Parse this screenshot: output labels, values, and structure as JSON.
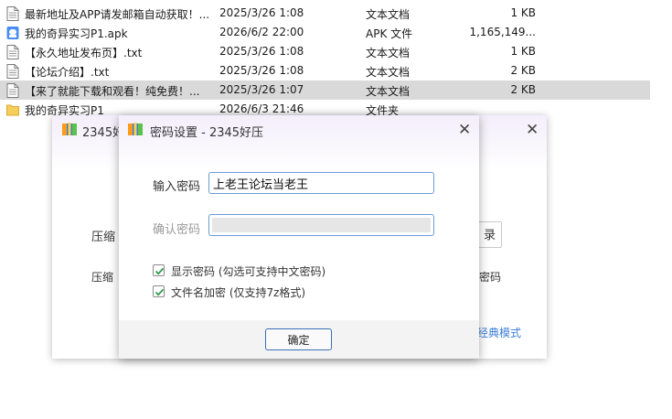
{
  "files": [
    {
      "name": "最新地址及APP请发邮箱自动获取！...",
      "date": "2025/3/26 1:08",
      "type": "文本文档",
      "size": "1 KB",
      "icon": "text-file-icon",
      "selected": false
    },
    {
      "name": "我的奇异实习P1.apk",
      "date": "2026/6/2 22:00",
      "type": "APK 文件",
      "size": "1,165,149...",
      "icon": "apk-file-icon",
      "selected": false
    },
    {
      "name": "【永久地址发布页】.txt",
      "date": "2025/3/26 1:08",
      "type": "文本文档",
      "size": "1 KB",
      "icon": "text-file-icon",
      "selected": false
    },
    {
      "name": "【论坛介绍】.txt",
      "date": "2025/3/26 1:08",
      "type": "文本文档",
      "size": "2 KB",
      "icon": "text-file-icon",
      "selected": false
    },
    {
      "name": "【来了就能下载和观看！纯免费！...",
      "date": "2025/3/26 1:07",
      "type": "文本文档",
      "size": "2 KB",
      "icon": "text-file-icon",
      "selected": true
    },
    {
      "name": "我的奇异实习P1",
      "date": "2026/6/3 21:46",
      "type": "文件夹",
      "size": "",
      "icon": "folder-icon",
      "selected": false
    }
  ],
  "main_window": {
    "title": "2345好",
    "label_compress": "压缩",
    "label_compress2": "压缩",
    "button_partial": "录",
    "label_right": "密码",
    "link_classic": "经典模式"
  },
  "dialog": {
    "title": "密码设置 - 2345好压",
    "password_label": "输入密码",
    "password_value": "上老王论坛当老王",
    "confirm_label": "确认密码",
    "show_password_label": "显示密码 (勾选可支持中文密码)",
    "show_password_checked": true,
    "encrypt_names_label": "文件名加密  (仅支持7z格式)",
    "encrypt_names_checked": true,
    "ok_label": "确定"
  },
  "colors": {
    "accent": "#3a7ed6",
    "check": "#2e9c4a",
    "selected_row": "#d9d9d9"
  }
}
